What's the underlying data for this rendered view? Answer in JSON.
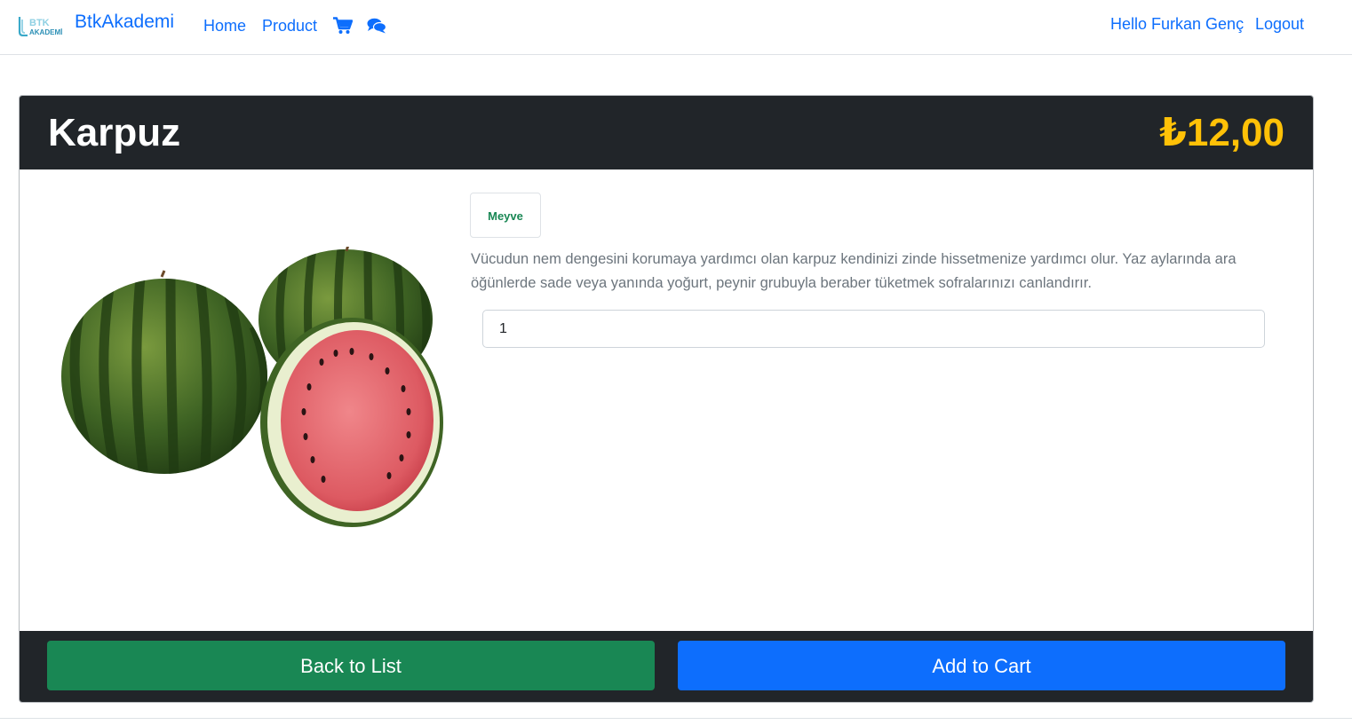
{
  "navbar": {
    "logo_text_top": "BTK",
    "logo_text_bottom": "AKADEMİ",
    "brand": "BtkAkademi",
    "links": {
      "home": "Home",
      "product": "Product"
    },
    "icons": {
      "cart": "cart-icon",
      "chat": "comments-icon"
    },
    "greeting": "Hello Furkan Genç",
    "logout": "Logout"
  },
  "product": {
    "name": "Karpuz",
    "price": "₺12,00",
    "category": "Meyve",
    "description": "Vücudun nem dengesini korumaya yardımcı olan karpuz kendinizi zinde hissetmenize yardımcı olur. Yaz aylarında ara öğünlerde sade veya yanında yoğurt, peynir grubuyla beraber tüketmek sofralarınızı canlandırır.",
    "quantity": "1"
  },
  "actions": {
    "back_label": "Back to List",
    "add_label": "Add to Cart"
  },
  "colors": {
    "brand": "#0d6efd",
    "header_bg": "#212529",
    "price": "#ffc107",
    "category": "#198754",
    "back_button": "#198754",
    "add_button": "#0d6efd"
  }
}
